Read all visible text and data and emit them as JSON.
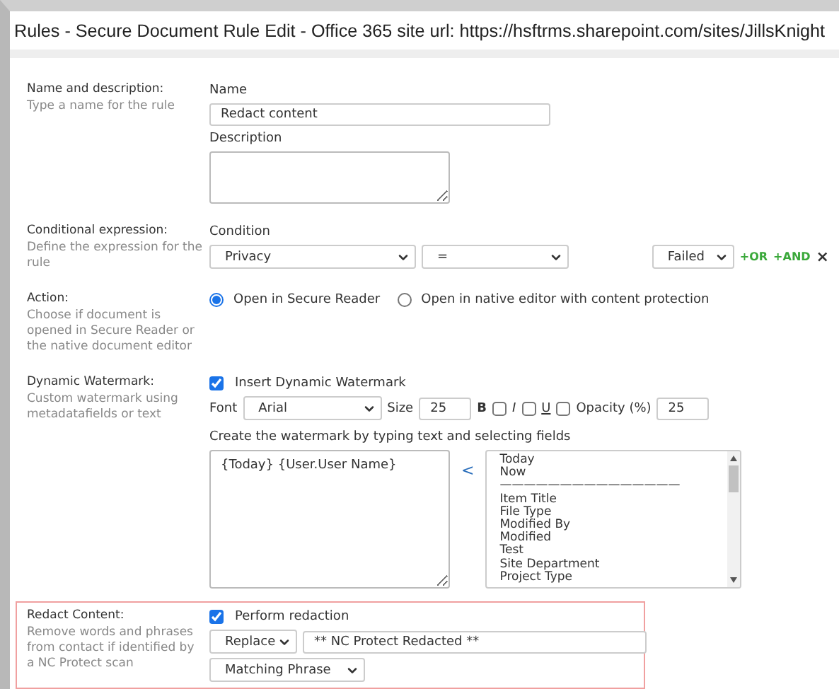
{
  "title": "Rules - Secure Document Rule Edit - Office 365 site url: https://hsftrms.sharepoint.com/sites/JillsKnight",
  "name_section": {
    "label": "Name and description:",
    "hint": "Type a name for the rule",
    "name_label": "Name",
    "name_value": "Redact content",
    "description_label": "Description"
  },
  "condition_section": {
    "label": "Conditional expression:",
    "hint": "Define the expression for the rule",
    "condition_label": "Condition",
    "field": "Privacy",
    "operator": "=",
    "value": "Failed",
    "or_link": "+OR",
    "and_link": "+AND",
    "remove": "×"
  },
  "action_section": {
    "label": "Action:",
    "hint": "Choose if document is opened in Secure Reader or the native document editor",
    "options": [
      {
        "label": "Open in Secure Reader",
        "selected": true
      },
      {
        "label": "Open in native editor with content protection",
        "selected": false
      }
    ]
  },
  "watermark_section": {
    "label": "Dynamic Watermark:",
    "hint": "Custom watermark using metadatafields or text",
    "insert_label": "Insert Dynamic Watermark",
    "insert_checked": true,
    "font_label": "Font",
    "font": "Arial",
    "size_label": "Size",
    "size": "25",
    "styles": [
      {
        "label": "B",
        "kind": "bold",
        "checked": false
      },
      {
        "label": "I",
        "kind": "italic",
        "checked": false
      },
      {
        "label": "U",
        "kind": "underline",
        "checked": false
      }
    ],
    "opacity_label": "Opacity (%)",
    "opacity": "25",
    "instructions": "Create the watermark by typing text and selecting fields",
    "text": "{Today} {User.User Name}",
    "insert_arrow": "<",
    "fields": [
      "Today",
      "Now",
      "———————————————",
      "Item Title",
      "File Type",
      "Modified By",
      "Modified",
      "Test",
      "Site Department",
      "Project Type"
    ]
  },
  "redact_section": {
    "label": "Redact Content:",
    "hint": "Remove words and phrases from contact if identified by a NC Protect scan",
    "highlighted": true,
    "perform_label": "Perform redaction",
    "perform_checked": true,
    "mode": "Replace",
    "replacement": "** NC Protect Redacted **",
    "scope": "Matching Phrase"
  }
}
